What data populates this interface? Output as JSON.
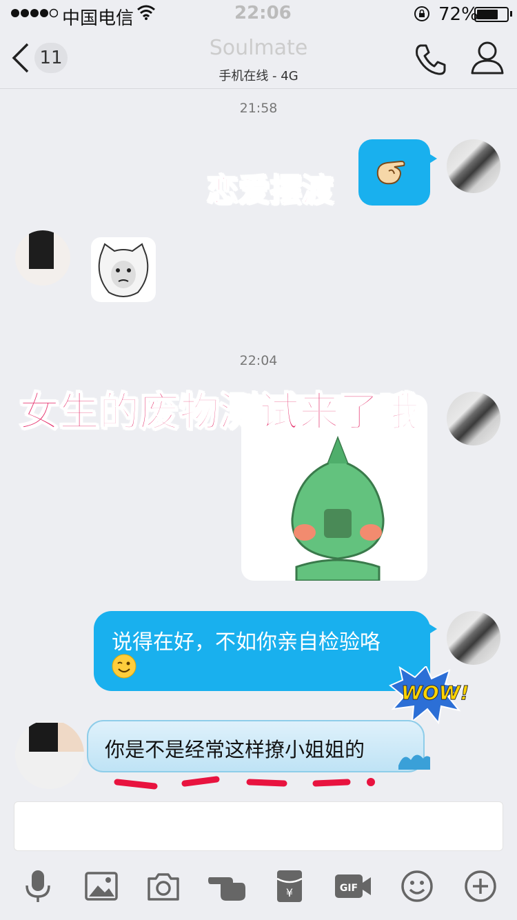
{
  "status_bar": {
    "carrier": "中国电信",
    "time": "22:06",
    "battery": "72%",
    "battery_level": 0.72
  },
  "nav": {
    "unread_count": "11",
    "title": "Soulmate",
    "subtitle": "手机在线 - 4G"
  },
  "messages": {
    "timestamp_1": "21:58",
    "overlay_1": "恋爱摆渡",
    "timestamp_2": "22:04",
    "overlay_2": "女生的废物测试来了哦",
    "text_outgoing": "说得在好，不如你亲自检验咯",
    "text_incoming": "你是不是经常这样撩小姐姐的",
    "wow_sticker": "WOW!"
  },
  "input": {
    "placeholder": ""
  },
  "colors": {
    "accent_blue": "#19b0ee",
    "overlay_pink": "#e5306c",
    "background": "#edeef2"
  },
  "icons": {
    "toolbar": [
      "microphone-icon",
      "image-icon",
      "camera-icon",
      "poke-icon",
      "red-packet-icon",
      "gif-icon",
      "emoji-icon",
      "plus-icon"
    ]
  }
}
